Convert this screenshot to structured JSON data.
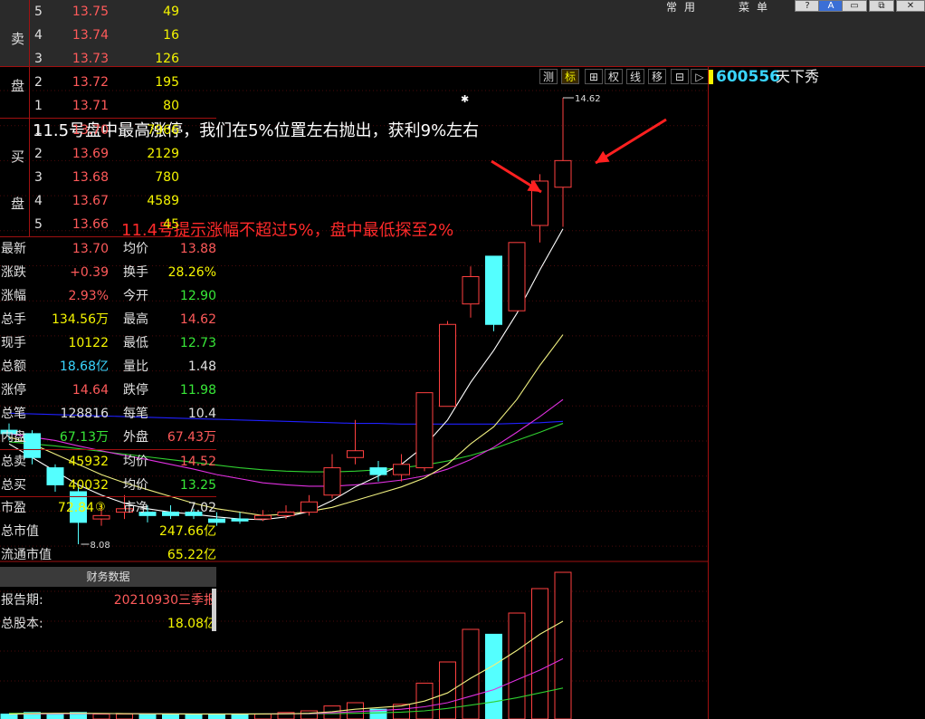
{
  "window": {
    "menu_common": "常用",
    "menu_menu": "菜单",
    "buttons": [
      "?",
      "A",
      "▭",
      "⧉",
      "✕"
    ]
  },
  "toolbar": {
    "items": [
      "测",
      "标",
      "⊞",
      "权",
      "线",
      "移",
      "⊟",
      "▷"
    ],
    "active_index": 1
  },
  "stock": {
    "code": "600556",
    "name": "天下秀"
  },
  "chart_annotations": {
    "note_top": "11.5号盘中最高涨停，我们在5%位置左右抛出，获利9%左右",
    "note_mid": "11.4号提示涨幅不超过5%，盘中最低探至2%",
    "high_label": "14.62",
    "low_label": "8.08",
    "marker": "✱"
  },
  "chart_data": {
    "type": "candlestick",
    "high_marker": 14.62,
    "low_marker": 8.08,
    "candles": [
      {
        "o": 9.75,
        "c": 9.7,
        "h": 9.85,
        "l": 9.6
      },
      {
        "o": 9.7,
        "c": 9.35,
        "h": 9.75,
        "l": 9.25
      },
      {
        "o": 9.2,
        "c": 8.95,
        "h": 9.25,
        "l": 8.85
      },
      {
        "o": 8.85,
        "c": 8.4,
        "h": 8.95,
        "l": 8.08
      },
      {
        "o": 8.45,
        "c": 8.5,
        "h": 8.65,
        "l": 8.35
      },
      {
        "o": 8.55,
        "c": 8.6,
        "h": 8.8,
        "l": 8.45
      },
      {
        "o": 8.55,
        "c": 8.5,
        "h": 8.65,
        "l": 8.4
      },
      {
        "o": 8.55,
        "c": 8.5,
        "h": 8.65,
        "l": 8.45
      },
      {
        "o": 8.55,
        "c": 8.5,
        "h": 8.6,
        "l": 8.45
      },
      {
        "o": 8.45,
        "c": 8.4,
        "h": 8.55,
        "l": 8.35
      },
      {
        "o": 8.45,
        "c": 8.42,
        "h": 8.55,
        "l": 8.38
      },
      {
        "o": 8.45,
        "c": 8.5,
        "h": 8.58,
        "l": 8.42
      },
      {
        "o": 8.5,
        "c": 8.55,
        "h": 8.65,
        "l": 8.45
      },
      {
        "o": 8.55,
        "c": 8.7,
        "h": 8.8,
        "l": 8.5
      },
      {
        "o": 8.8,
        "c": 9.2,
        "h": 9.4,
        "l": 8.75
      },
      {
        "o": 9.35,
        "c": 9.45,
        "h": 9.9,
        "l": 9.25
      },
      {
        "o": 9.2,
        "c": 9.1,
        "h": 9.3,
        "l": 9.0
      },
      {
        "o": 9.1,
        "c": 9.25,
        "h": 9.4,
        "l": 9.0
      },
      {
        "o": 9.2,
        "c": 10.3,
        "h": 10.3,
        "l": 9.15
      },
      {
        "o": 10.1,
        "c": 11.3,
        "h": 11.35,
        "l": 10.1
      },
      {
        "o": 11.6,
        "c": 12.0,
        "h": 12.15,
        "l": 11.4
      },
      {
        "o": 12.3,
        "c": 11.3,
        "h": 12.3,
        "l": 11.2
      },
      {
        "o": 11.5,
        "c": 12.5,
        "h": 12.5,
        "l": 11.5
      },
      {
        "o": 12.75,
        "c": 13.4,
        "h": 13.5,
        "l": 12.5
      },
      {
        "o": 13.31,
        "c": 13.7,
        "h": 14.62,
        "l": 12.73
      }
    ],
    "ma_white": [
      9.55,
      9.35,
      9.15,
      8.95,
      8.8,
      8.68,
      8.6,
      8.55,
      8.52,
      8.48,
      8.45,
      8.44,
      8.48,
      8.56,
      8.72,
      8.92,
      9.08,
      9.25,
      9.52,
      9.9,
      10.45,
      10.92,
      11.46,
      12.1,
      12.7
    ],
    "ma_yellow": [
      9.65,
      9.55,
      9.4,
      9.25,
      9.1,
      8.98,
      8.88,
      8.78,
      8.68,
      8.6,
      8.55,
      8.5,
      8.52,
      8.56,
      8.62,
      8.72,
      8.82,
      8.92,
      9.05,
      9.25,
      9.55,
      9.8,
      10.2,
      10.7,
      11.15
    ],
    "ma_magenta": [
      9.7,
      9.65,
      9.6,
      9.52,
      9.45,
      9.38,
      9.32,
      9.25,
      9.18,
      9.1,
      9.04,
      8.98,
      8.95,
      8.93,
      8.93,
      8.95,
      8.98,
      9.02,
      9.08,
      9.18,
      9.32,
      9.5,
      9.72,
      9.95,
      10.2
    ],
    "ma_green": [
      9.58,
      9.55,
      9.52,
      9.48,
      9.44,
      9.4,
      9.36,
      9.32,
      9.28,
      9.24,
      9.2,
      9.17,
      9.15,
      9.14,
      9.14,
      9.15,
      9.17,
      9.2,
      9.24,
      9.3,
      9.38,
      9.48,
      9.6,
      9.72,
      9.85
    ],
    "ma_blue": [
      10.0,
      9.99,
      9.98,
      9.97,
      9.96,
      9.95,
      9.94,
      9.93,
      9.92,
      9.91,
      9.9,
      9.89,
      9.88,
      9.87,
      9.86,
      9.85,
      9.85,
      9.84,
      9.84,
      9.84,
      9.84,
      9.84,
      9.85,
      9.86,
      9.88
    ],
    "volume": [
      3,
      4,
      3,
      4,
      3,
      3,
      3,
      3,
      3,
      3,
      3,
      3,
      4,
      5,
      8,
      10,
      6,
      9,
      22,
      35,
      55,
      52,
      65,
      80,
      90
    ],
    "vol_ma_yellow": [
      3,
      3.3,
      3.5,
      3.5,
      3.4,
      3.3,
      3.2,
      3.1,
      3,
      3,
      3,
      3.1,
      3.2,
      3.5,
      4.5,
      6,
      7,
      8,
      11,
      16,
      25,
      33,
      42,
      52,
      60
    ],
    "vol_ma_magenta": [
      3,
      3.1,
      3.2,
      3.3,
      3.3,
      3.3,
      3.2,
      3.2,
      3.1,
      3.1,
      3.1,
      3.1,
      3.2,
      3.3,
      3.8,
      4.5,
      5.2,
      6,
      7.5,
      10,
      14,
      18,
      24,
      30,
      37
    ],
    "vol_ma_green": [
      3.5,
      3.5,
      3.4,
      3.4,
      3.4,
      3.3,
      3.3,
      3.3,
      3.2,
      3.2,
      3.2,
      3.2,
      3.2,
      3.2,
      3.3,
      3.5,
      3.8,
      4.2,
      5,
      6.5,
      8.5,
      10.5,
      13,
      16,
      19
    ]
  },
  "order_book": {
    "sell_label": [
      "卖",
      "盘"
    ],
    "buy_label": [
      "买",
      "盘"
    ],
    "asks": [
      {
        "level": "5",
        "price": "13.75",
        "vol": "49"
      },
      {
        "level": "4",
        "price": "13.74",
        "vol": "16"
      },
      {
        "level": "3",
        "price": "13.73",
        "vol": "126"
      },
      {
        "level": "2",
        "price": "13.72",
        "vol": "195"
      },
      {
        "level": "1",
        "price": "13.71",
        "vol": "80"
      }
    ],
    "bids": [
      {
        "level": "1",
        "price": "13.70",
        "vol": "7966"
      },
      {
        "level": "2",
        "price": "13.69",
        "vol": "2129"
      },
      {
        "level": "3",
        "price": "13.68",
        "vol": "780"
      },
      {
        "level": "4",
        "price": "13.67",
        "vol": "4589"
      },
      {
        "level": "5",
        "price": "13.66",
        "vol": "45"
      }
    ]
  },
  "quote": [
    {
      "k1": "最新",
      "v1": "13.70",
      "c1": "#ff5a5a",
      "k2": "均价",
      "v2": "13.88",
      "c2": "#ff5a5a"
    },
    {
      "k1": "涨跌",
      "v1": "+0.39",
      "c1": "#ff5a5a",
      "k2": "换手",
      "v2": "28.26%",
      "c2": "#f5f500"
    },
    {
      "k1": "涨幅",
      "v1": "2.93%",
      "c1": "#ff5a5a",
      "k2": "今开",
      "v2": "12.90",
      "c2": "#38e838"
    },
    {
      "k1": "总手",
      "v1": "134.56万",
      "c1": "#f5f500",
      "k2": "最高",
      "v2": "14.62",
      "c2": "#ff5a5a"
    },
    {
      "k1": "现手",
      "v1": "10122",
      "c1": "#f5f500",
      "k2": "最低",
      "v2": "12.73",
      "c2": "#38e838"
    },
    {
      "k1": "总额",
      "v1": "18.68亿",
      "c1": "#3ad6ff",
      "k2": "量比",
      "v2": "1.48",
      "c2": "#e0e0e0"
    },
    {
      "k1": "涨停",
      "v1": "14.64",
      "c1": "#ff5a5a",
      "k2": "跌停",
      "v2": "11.98",
      "c2": "#38e838"
    },
    {
      "k1": "总笔",
      "v1": "128816",
      "c1": "#e0e0e0",
      "k2": "每笔",
      "v2": "10.4",
      "c2": "#e0e0e0"
    },
    {
      "k1": "内盘",
      "v1": "67.13万",
      "c1": "#38e838",
      "k2": "外盘",
      "v2": "67.43万",
      "c2": "#ff5a5a"
    }
  ],
  "totals": [
    {
      "k1": "总卖",
      "v1": "45932",
      "c1": "#f5f500",
      "k2": "均价",
      "v2": "14.52",
      "c2": "#ff5a5a"
    },
    {
      "k1": "总买",
      "v1": "40032",
      "c1": "#f5f500",
      "k2": "均价",
      "v2": "13.25",
      "c2": "#38e838"
    }
  ],
  "valuation": {
    "pe_label": "市盈",
    "pe_value": "72.84",
    "pe_badge": "③",
    "pb_label": "市净",
    "pb_value": "7.02",
    "mktcap_label": "总市值",
    "mktcap_value": "247.66亿",
    "float_label": "流通市值",
    "float_value": "65.22亿"
  },
  "finance": {
    "header": "财务数据",
    "report_label": "报告期:",
    "report_value": "20210930三季报",
    "shares_label": "总股本:",
    "shares_value": "18.08亿"
  }
}
